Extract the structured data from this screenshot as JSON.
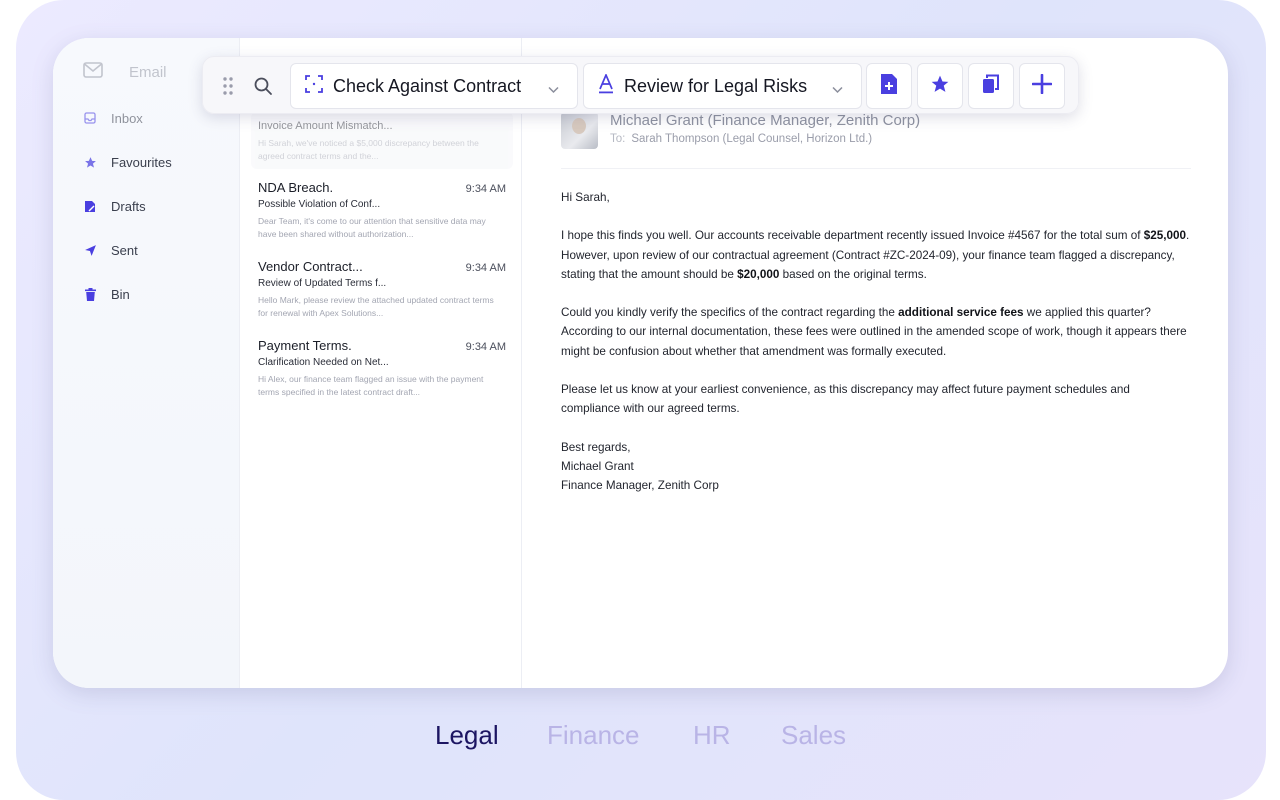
{
  "app": {
    "title": "Email"
  },
  "sidebar": {
    "items": [
      {
        "label": "Inbox",
        "icon": "inbox-icon"
      },
      {
        "label": "Favourites",
        "icon": "star-icon"
      },
      {
        "label": "Drafts",
        "icon": "draft-icon"
      },
      {
        "label": "Sent",
        "icon": "send-icon"
      },
      {
        "label": "Bin",
        "icon": "trash-icon"
      }
    ]
  },
  "toolbar": {
    "dropdown1": {
      "label": "Check Against Contract",
      "icon": "scan-icon"
    },
    "dropdown2": {
      "label": "Review for Legal Risks",
      "icon": "text-style-icon"
    },
    "buttons": [
      "add-document-icon",
      "star-icon",
      "copy-icon",
      "plus-icon"
    ]
  },
  "mail_list": [
    {
      "sender": "",
      "time": "",
      "subject": "Invoice Amount Mismatch...",
      "preview": "Hi Sarah, we've noticed a $5,000 discrepancy between the agreed contract terms and the..."
    },
    {
      "sender": "NDA Breach.",
      "time": "9:34 AM",
      "subject": "Possible Violation of Conf...",
      "preview": "Dear Team, it's come to our attention that sensitive data may have been shared without authorization..."
    },
    {
      "sender": "Vendor Contract...",
      "time": "9:34 AM",
      "subject": "Review of Updated Terms f...",
      "preview": "Hello Mark, please review the attached updated contract terms for renewal with Apex Solutions..."
    },
    {
      "sender": "Payment Terms.",
      "time": "9:34 AM",
      "subject": "Clarification Needed on Net...",
      "preview": "Hi Alex, our finance team flagged an issue with the payment terms specified in the latest contract draft..."
    }
  ],
  "message": {
    "from": "Michael Grant (Finance Manager, Zenith Corp)",
    "to_label": "To:",
    "to": "Sarah Thompson (Legal Counsel, Horizon Ltd.)",
    "greeting": "Hi Sarah,",
    "p1_a": "I hope this finds you well. Our accounts receivable department recently issued Invoice #4567 for the total sum of ",
    "p1_b": "$25,000",
    "p1_c": ". However, upon review of our contractual agreement (Contract #ZC-2024-09), your finance team flagged a discrepancy, stating that the amount should be ",
    "p1_d": "$20,000",
    "p1_e": " based on the original terms.",
    "p2_a": "Could you kindly verify the specifics of the contract regarding the ",
    "p2_b": "additional service fees",
    "p2_c": " we applied this quarter? According to our internal documentation, these fees were outlined in the amended scope of work, though it appears there might be confusion about whether that amendment was formally executed.",
    "p3": "Please let us know at your earliest convenience, as this discrepancy may affect future payment schedules and compliance with our agreed terms.",
    "sign1": "Best regards,",
    "sign2": "Michael Grant",
    "sign3": "Finance Manager, Zenith Corp"
  },
  "categories": [
    {
      "label": "Legal",
      "active": true
    },
    {
      "label": "Finance",
      "active": false
    },
    {
      "label": "HR",
      "active": false
    },
    {
      "label": "Sales",
      "active": false
    }
  ],
  "colors": {
    "accent": "#4a3fe0",
    "active_tab": "#1c1562",
    "inactive_tab": "#b9b4e6"
  }
}
